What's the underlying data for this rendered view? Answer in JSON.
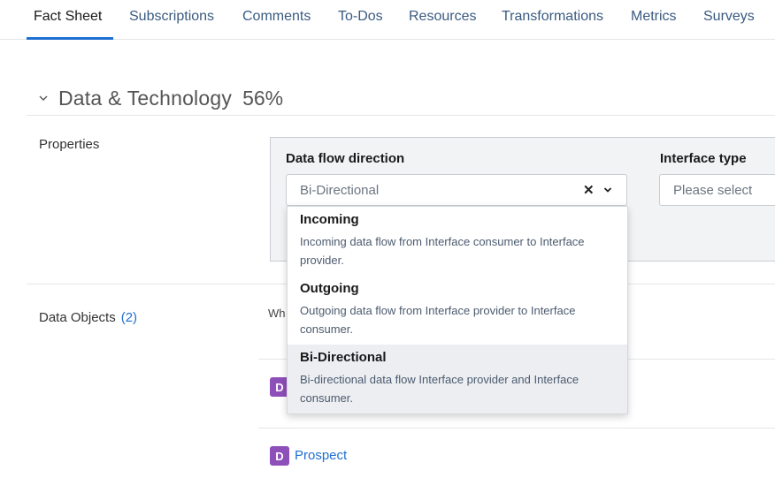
{
  "tabs": [
    {
      "label": "Fact Sheet",
      "active": true
    },
    {
      "label": "Subscriptions"
    },
    {
      "label": "Comments"
    },
    {
      "label": "To-Dos"
    },
    {
      "label": "Resources"
    },
    {
      "label": "Transformations"
    },
    {
      "label": "Metrics"
    },
    {
      "label": "Surveys"
    }
  ],
  "section": {
    "title": "Data & Technology",
    "completion": "56%"
  },
  "properties": {
    "label": "Properties",
    "data_flow": {
      "label": "Data flow direction",
      "value": "Bi-Directional",
      "options": [
        {
          "title": "Incoming",
          "description": "Incoming data flow from Interface consumer to Interface provider."
        },
        {
          "title": "Outgoing",
          "description": "Outgoing data flow from Interface provider to Interface consumer."
        },
        {
          "title": "Bi-Directional",
          "description": "Bi-directional data flow Interface provider and Interface consumer.",
          "selected": true
        }
      ]
    },
    "interface_type": {
      "label": "Interface type",
      "placeholder": "Please select"
    }
  },
  "data_objects": {
    "label": "Data Objects",
    "count": "(2)",
    "partial_text": "Wh",
    "items": [
      {
        "badge": "D",
        "name": ""
      },
      {
        "badge": "D",
        "name": "Prospect"
      }
    ]
  },
  "colors": {
    "accent": "#1f6fd1",
    "badge": "#8d4fb8",
    "panel_bg": "#f2f3f5"
  }
}
